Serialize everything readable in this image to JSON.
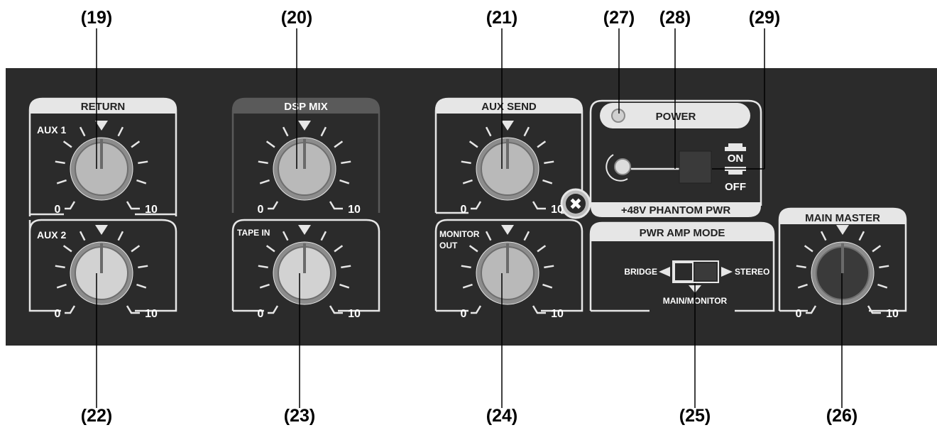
{
  "callouts": {
    "c19": "(19)",
    "c20": "(20)",
    "c21": "(21)",
    "c27": "(27)",
    "c28": "(28)",
    "c29": "(29)",
    "c22": "(22)",
    "c23": "(23)",
    "c24": "(24)",
    "c25": "(25)",
    "c26": "(26)"
  },
  "sections": {
    "return": "RETURN",
    "dsp_mix": "DSP MIX",
    "aux_send": "AUX SEND",
    "power": "POWER",
    "phantom": "+48V PHANTOM PWR",
    "pwr_amp_mode": "PWR AMP MODE",
    "main_master": "MAIN MASTER"
  },
  "knob_labels": {
    "aux1": "AUX 1",
    "aux2": "AUX 2",
    "tape_in": "TAPE IN",
    "monitor_out_1": "MONITOR",
    "monitor_out_2": "OUT"
  },
  "scale": {
    "min": "0",
    "max": "10"
  },
  "power_switch": {
    "on": "ON",
    "off": "OFF"
  },
  "amp_mode": {
    "left": "BRIDGE",
    "right": "STEREO",
    "bottom": "MAIN/MONITOR"
  },
  "colors": {
    "panel": "#2b2b2b",
    "knob_gray": "#b9b9b9",
    "knob_light": "#d2d2d2",
    "knob_dark": "#3a3a3a",
    "led": "#d0d0d0"
  }
}
